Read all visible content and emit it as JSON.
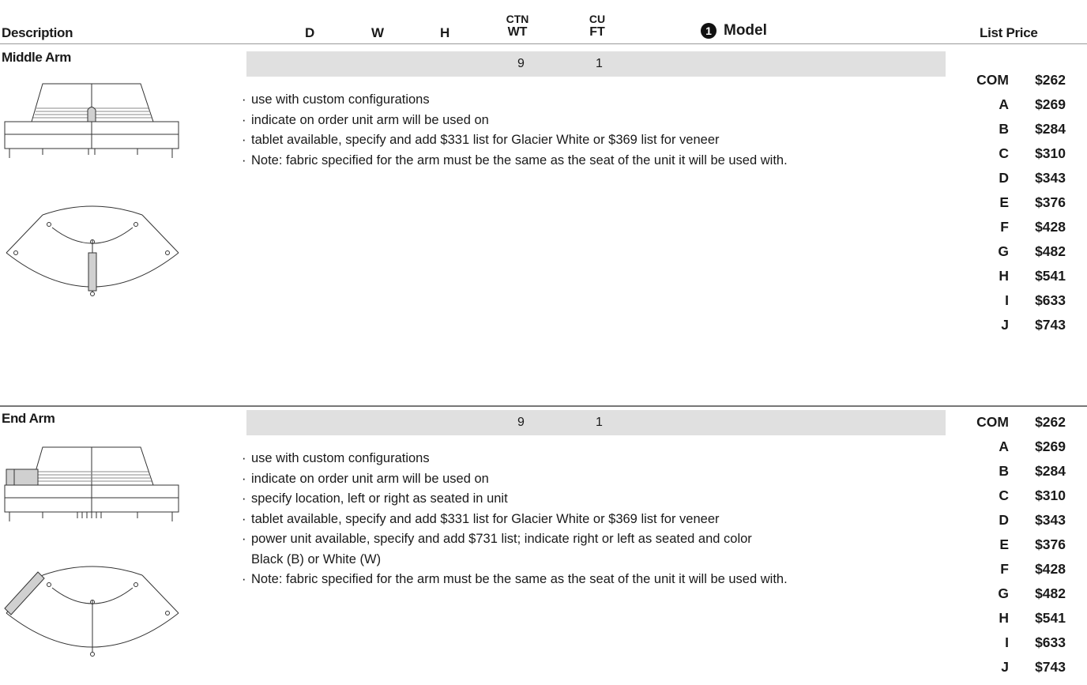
{
  "header": {
    "description": "Description",
    "d": "D",
    "w": "W",
    "h": "H",
    "ctn_wt_1": "CTN",
    "ctn_wt_2": "WT",
    "cu_ft_1": "CU",
    "cu_ft_2": "FT",
    "model_marker": "1",
    "model": "Model",
    "list_price": "List Price"
  },
  "sections": [
    {
      "title": "Middle Arm",
      "ctn_wt": "9",
      "cu_ft": "1",
      "notes": [
        "use with custom configurations",
        "indicate on order unit arm will be used on",
        "tablet available, specify and add $331 list for Glacier White or $369 list for veneer",
        "Note: fabric specified for the arm must be the same as the seat of the unit it will be used with."
      ],
      "prices": [
        {
          "grade": "COM",
          "price": "$262"
        },
        {
          "grade": "A",
          "price": "$269"
        },
        {
          "grade": "B",
          "price": "$284"
        },
        {
          "grade": "C",
          "price": "$310"
        },
        {
          "grade": "D",
          "price": "$343"
        },
        {
          "grade": "E",
          "price": "$376"
        },
        {
          "grade": "F",
          "price": "$428"
        },
        {
          "grade": "G",
          "price": "$482"
        },
        {
          "grade": "H",
          "price": "$541"
        },
        {
          "grade": "I",
          "price": "$633"
        },
        {
          "grade": "J",
          "price": "$743"
        }
      ]
    },
    {
      "title": "End Arm",
      "ctn_wt": "9",
      "cu_ft": "1",
      "notes": [
        "use with custom configurations",
        "indicate on order unit arm will be used on",
        "specify location, left or right as seated in unit",
        "tablet available, specify and add $331 list for Glacier White or $369 list for veneer",
        "power unit available, specify and add $731 list; indicate right or left as seated and color\nBlack (B) or White (W)",
        "Note: fabric specified for the arm must be the same as the seat of the unit it will be used with."
      ],
      "prices": [
        {
          "grade": "COM",
          "price": "$262"
        },
        {
          "grade": "A",
          "price": "$269"
        },
        {
          "grade": "B",
          "price": "$284"
        },
        {
          "grade": "C",
          "price": "$310"
        },
        {
          "grade": "D",
          "price": "$343"
        },
        {
          "grade": "E",
          "price": "$376"
        },
        {
          "grade": "F",
          "price": "$428"
        },
        {
          "grade": "G",
          "price": "$482"
        },
        {
          "grade": "H",
          "price": "$541"
        },
        {
          "grade": "I",
          "price": "$633"
        },
        {
          "grade": "J",
          "price": "$743"
        }
      ]
    }
  ]
}
